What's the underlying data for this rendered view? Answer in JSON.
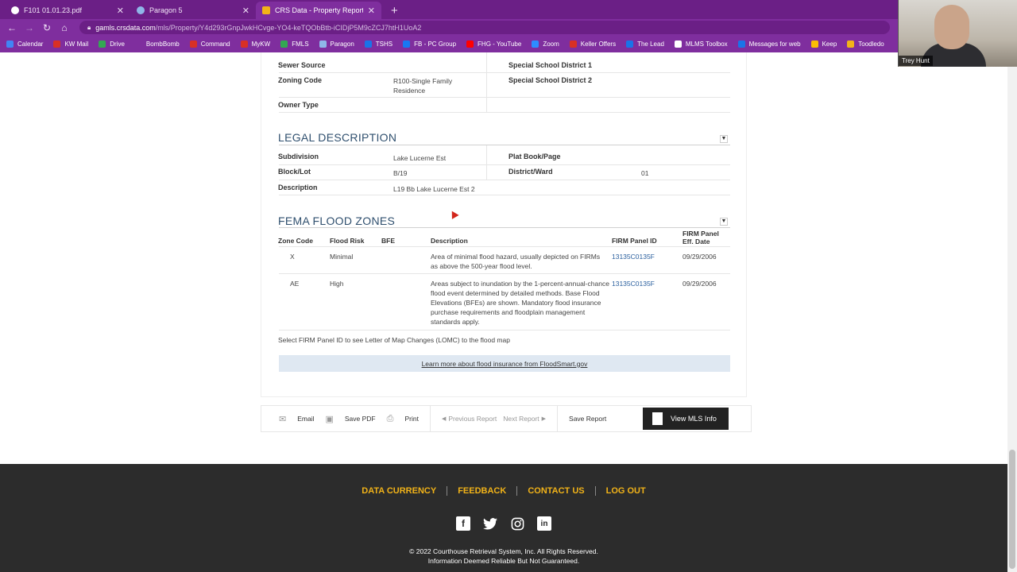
{
  "browser": {
    "tabs": [
      {
        "title": "F101 01.01.23.pdf",
        "icon": "globe-icon",
        "color": "#ffffff"
      },
      {
        "title": "Paragon 5",
        "icon": "paragon-icon",
        "color": "#8fb6e8"
      },
      {
        "title": "CRS Data - Property Report for F",
        "icon": "crs-icon",
        "color": "#f2b318",
        "active": true
      }
    ],
    "url_host": "gamls.crsdata.com",
    "url_path": "/mls/Property/Y4d293rGnpJwkHCvge-YO4-keTQObBtb-iCIDjP5M9cZCJ7htH1UoA2",
    "bookmarks": [
      {
        "label": "Calendar",
        "color": "#4285f4"
      },
      {
        "label": "KW Mail",
        "color": "#d93025"
      },
      {
        "label": "Drive",
        "color": "#34a853"
      },
      {
        "label": "BombBomb",
        "color": "#7f2e9e"
      },
      {
        "label": "Command",
        "color": "#d93025"
      },
      {
        "label": "MyKW",
        "color": "#d93025"
      },
      {
        "label": "FMLS",
        "color": "#34a853"
      },
      {
        "label": "Paragon",
        "color": "#8fb6e8"
      },
      {
        "label": "TSHS",
        "color": "#1a73e8"
      },
      {
        "label": "FB - PC Group",
        "color": "#1877f2"
      },
      {
        "label": "FHG - YouTube",
        "color": "#ff0000"
      },
      {
        "label": "Zoom",
        "color": "#2d8cff"
      },
      {
        "label": "Keller Offers",
        "color": "#d93025"
      },
      {
        "label": "The Lead",
        "color": "#1a73e8"
      },
      {
        "label": "MLMS Toolbox",
        "color": "#ffffff"
      },
      {
        "label": "Messages for web",
        "color": "#1a73e8"
      },
      {
        "label": "Keep",
        "color": "#fbbc04"
      },
      {
        "label": "Toodledo",
        "color": "#f2b318"
      }
    ]
  },
  "webcam": {
    "name": "Trey Hunt"
  },
  "property_rows": [
    {
      "label": "Sewer Source",
      "value": "",
      "label2": "Special School District 1",
      "value2": ""
    },
    {
      "label": "Zoning Code",
      "value": "R100-Single Family Residence",
      "label2": "Special School District 2",
      "value2": ""
    },
    {
      "label": "Owner Type",
      "value": "",
      "label2": "",
      "value2": ""
    }
  ],
  "legal": {
    "title": "LEGAL DESCRIPTION",
    "rows": [
      {
        "label": "Subdivision",
        "value": "Lake Lucerne Est",
        "label2": "Plat Book/Page",
        "value2": ""
      },
      {
        "label": "Block/Lot",
        "value": "B/19",
        "label2": "District/Ward",
        "value2": "01"
      },
      {
        "label": "Description",
        "value": "L19 Bb Lake Lucerne Est 2",
        "label2": "",
        "value2": ""
      }
    ]
  },
  "fema": {
    "title": "FEMA FLOOD ZONES",
    "headers": {
      "zone": "Zone Code",
      "risk": "Flood Risk",
      "bfe": "BFE",
      "desc": "Description",
      "panel": "FIRM Panel ID",
      "date": "FIRM Panel Eff. Date"
    },
    "rows": [
      {
        "zone": "X",
        "risk": "Minimal",
        "bfe": "",
        "desc": "Area of minimal flood hazard, usually depicted on FIRMs as above the 500-year flood level.",
        "panel": "13135C0135F",
        "date": "09/29/2006"
      },
      {
        "zone": "AE",
        "risk": "High",
        "bfe": "",
        "desc": "Areas subject to inundation by the 1-percent-annual-chance flood event determined by detailed methods. Base Flood Elevations (BFEs) are shown. Mandatory flood insurance purchase requirements and floodplain management standards apply.",
        "panel": "13135C0135F",
        "date": "09/29/2006"
      }
    ],
    "note": "Select FIRM Panel ID to see Letter of Map Changes (LOMC) to the flood map",
    "floodsmart": "Learn more about flood insurance from FloodSmart.gov"
  },
  "actions": {
    "email": "Email",
    "save_pdf": "Save PDF",
    "print": "Print",
    "previous": "Previous Report",
    "next": "Next Report",
    "save_report": "Save Report",
    "view_mls": "View MLS Info"
  },
  "footer": {
    "links": [
      "DATA CURRENCY",
      "FEEDBACK",
      "CONTACT US",
      "LOG OUT"
    ],
    "copyright": "© 2022 Courthouse Retrieval System, Inc. All Rights Reserved.",
    "disclaimer": "Information Deemed Reliable But Not Guaranteed."
  }
}
